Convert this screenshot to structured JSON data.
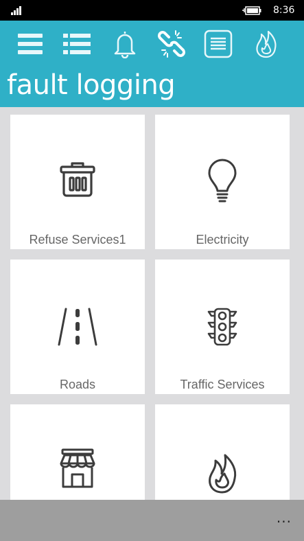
{
  "status": {
    "time": "8:36"
  },
  "header": {
    "title": "fault logging",
    "nav_icons": [
      "menu-icon",
      "list-icon",
      "bell-icon",
      "broken-link-icon",
      "document-icon",
      "fire-icon"
    ]
  },
  "tiles": [
    {
      "label": "Refuse Services1",
      "icon": "trash-bin-icon"
    },
    {
      "label": "Electricity",
      "icon": "light-bulb-icon"
    },
    {
      "label": "Roads",
      "icon": "road-icon"
    },
    {
      "label": "Traffic Services",
      "icon": "traffic-light-icon"
    },
    {
      "label": "",
      "icon": "shop-icon"
    },
    {
      "label": "",
      "icon": "fire-icon"
    }
  ],
  "app_bar": {
    "more_label": "..."
  },
  "colors": {
    "accent": "#2fb0c7",
    "tile_label": "#666666",
    "icon_stroke": "#3c3c3c"
  }
}
